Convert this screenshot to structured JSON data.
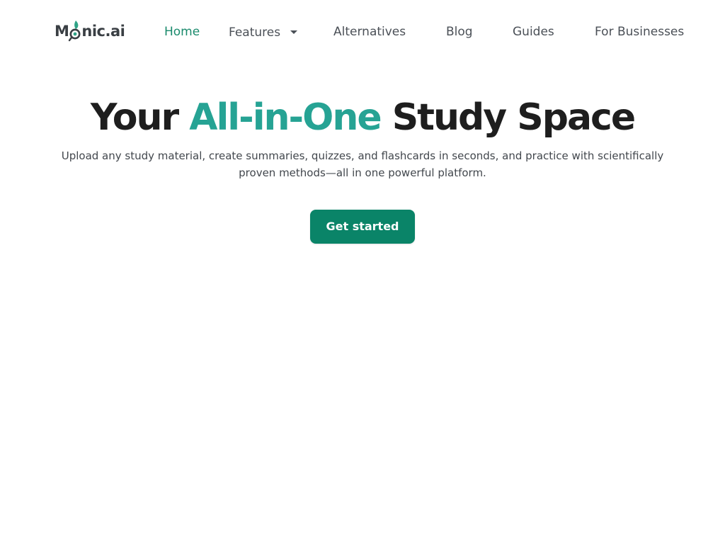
{
  "brand": {
    "logo_prefix": "M",
    "logo_suffix": "nic.ai",
    "logo_icon": "droplet-leaf-icon",
    "logo_accent_color": "#2fa386"
  },
  "nav": {
    "home": "Home",
    "features": "Features",
    "alternatives": "Alternatives",
    "blog": "Blog",
    "guides": "Guides",
    "for_businesses": "For Businesses",
    "active_item": "Home"
  },
  "hero": {
    "title_start": "Your ",
    "title_accent": "All-in-One",
    "title_end": " Study Space",
    "subtitle": "Upload any study material, create summaries, quizzes, and flashcards in seconds, and practice with scientifically proven methods—all in one powerful platform.",
    "cta_label": "Get started"
  },
  "colors": {
    "accent": "#26a394",
    "nav_active": "#1a8a6c",
    "cta_background": "#0a8468",
    "text_dark": "#1e1e1e"
  }
}
